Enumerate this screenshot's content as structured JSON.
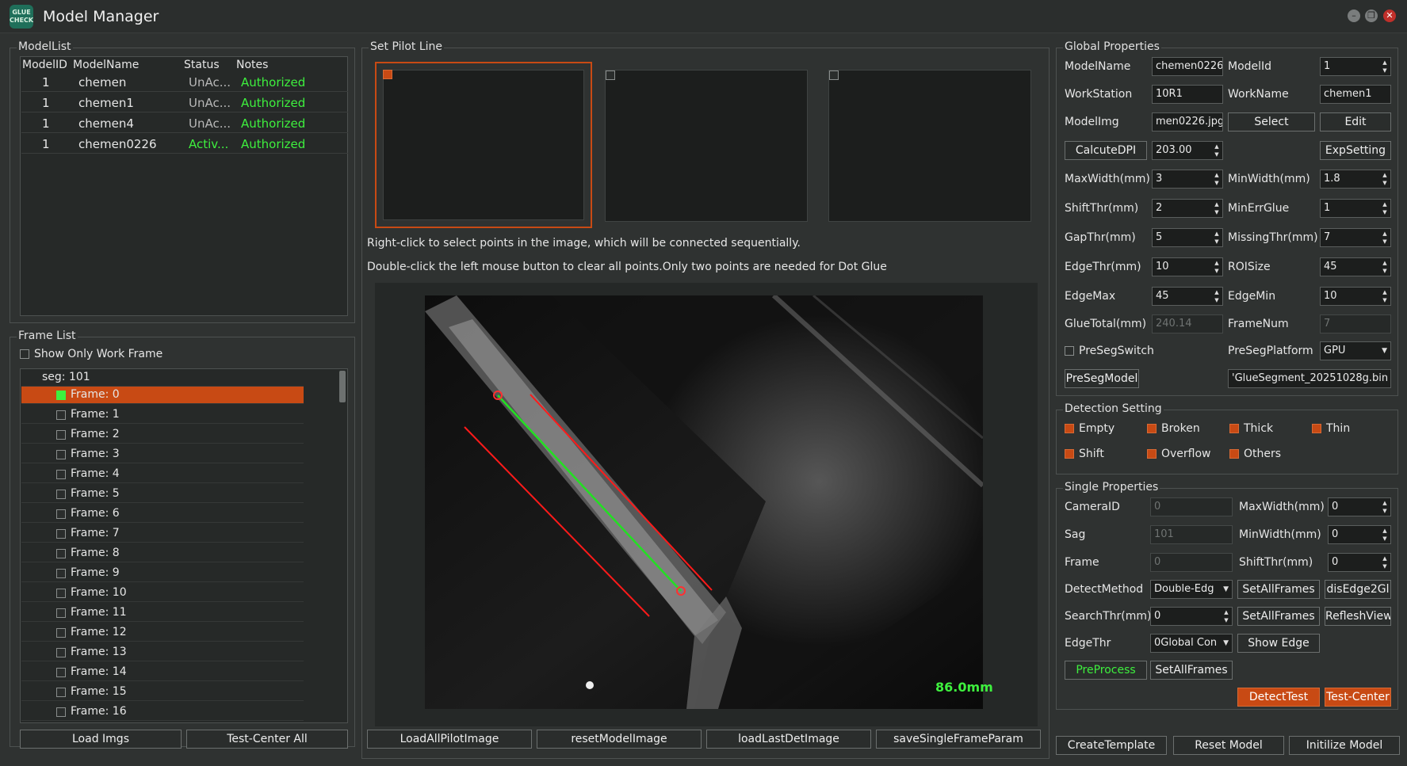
{
  "window": {
    "title": "Model Manager",
    "logo": "GLUE CHECK",
    "controls": [
      "minimize-icon",
      "restore-icon",
      "close-icon"
    ]
  },
  "modellist": {
    "title": "ModelList",
    "columns": [
      "ModelID",
      "ModelName",
      "Status",
      "Notes"
    ],
    "rows": [
      {
        "id": "1",
        "name": "chemen",
        "status": "UnAc...",
        "notes": "Authorized"
      },
      {
        "id": "1",
        "name": "chemen1",
        "status": "UnAc...",
        "notes": "Authorized"
      },
      {
        "id": "1",
        "name": "chemen4",
        "status": "UnAc...",
        "notes": "Authorized"
      },
      {
        "id": "1",
        "name": "chemen0226",
        "status": "Activ...",
        "notes": "Authorized"
      }
    ]
  },
  "framelist": {
    "title": "Frame List",
    "show_only_label": "Show Only Work Frame",
    "seg": "seg: 101",
    "frames": [
      "Frame: 0",
      "Frame: 1",
      "Frame: 2",
      "Frame: 3",
      "Frame: 4",
      "Frame: 5",
      "Frame: 6",
      "Frame: 7",
      "Frame: 8",
      "Frame: 9",
      "Frame: 10",
      "Frame: 11",
      "Frame: 12",
      "Frame: 13",
      "Frame: 14",
      "Frame: 15",
      "Frame: 16"
    ],
    "load_imgs": "Load Imgs",
    "test_center_all": "Test-Center All"
  },
  "pilot": {
    "title": "Set Pilot Line",
    "hint1": "Right-click to select points in the image, which will be connected sequentially.",
    "hint2": "Double-click the left mouse button to clear all points.Only two points are needed for Dot Glue",
    "measure": "86.0mm",
    "buttons": [
      "LoadAllPilotImage",
      "resetModelImage",
      "loadLastDetImage",
      "saveSingleFrameParam"
    ]
  },
  "global": {
    "title": "Global Properties",
    "modelname_label": "ModelName",
    "modelname": "chemen0226",
    "modelid_label": "ModelId",
    "modelid": "1",
    "workstation_label": "WorkStation",
    "workstation": "10R1",
    "workname_label": "WorkName",
    "workname": "chemen1",
    "modelimg_label": "ModelImg",
    "modelimg": "men0226.jpg",
    "select": "Select",
    "edit": "Edit",
    "calcdpi": "CalcuteDPI",
    "dpi": "203.00",
    "expsetting": "ExpSetting",
    "maxwidth_label": "MaxWidth(mm)",
    "maxwidth": "3",
    "minwidth_label": "MinWidth(mm)",
    "minwidth": "1.8",
    "shiftthr_label": "ShiftThr(mm)",
    "shiftthr": "2",
    "minerr_label": "MinErrGlue",
    "minerr": "1",
    "gapthr_label": "GapThr(mm)",
    "gapthr": "5",
    "missing_label": "MissingThr(mm)",
    "missing": "7",
    "edgethr_label": "EdgeThr(mm)",
    "edgethr": "10",
    "roisize_label": "ROISize",
    "roisize": "45",
    "edgemax_label": "EdgeMax",
    "edgemax": "45",
    "edgemin_label": "EdgeMin",
    "edgemin": "10",
    "gluetotal_label": "GlueTotal(mm)",
    "gluetotal": "240.14",
    "framenum_label": "FrameNum",
    "framenum": "7",
    "preseg_label": "PreSegSwitch",
    "platform_label": "PreSegPlatform",
    "platform": "GPU",
    "presegmodel": "PreSegModel",
    "presegfile": "'GlueSegment_20251028g.bin"
  },
  "detection": {
    "title": "Detection Setting",
    "items": [
      "Empty",
      "Broken",
      "Thick",
      "Thin",
      "Shift",
      "Overflow",
      "Others"
    ]
  },
  "single": {
    "title": "Single Properties",
    "camera_label": "CameraID",
    "camera": "0",
    "maxwidth_label": "MaxWidth(mm)",
    "maxwidth": "0",
    "sag_label": "Sag",
    "sag": "101",
    "minwidth_label": "MinWidth(mm)",
    "minwidth": "0",
    "frame_label": "Frame",
    "frame": "0",
    "shiftthr_label": "ShiftThr(mm)",
    "shiftthr": "0",
    "detectmethod_label": "DetectMethod",
    "detectmethod": "Double-Edg",
    "setall1": "SetAllFrames",
    "disedge": "disEdge2Gl",
    "searchthr_label": "SearchThr(mm)",
    "searchthr": "0",
    "setall2": "SetAllFrames",
    "refresh": "RefleshView",
    "edgethr_label": "EdgeThr",
    "edgethr": "0Global Con",
    "showedge": "Show Edge",
    "preprocess": "PreProcess",
    "setall3": "SetAllFrames",
    "detecttest": "DetectTest",
    "testcenter": "Test-Center"
  },
  "bottom": {
    "create": "CreateTemplate",
    "reset": "Reset Model",
    "init": "Initilize Model"
  },
  "colors": {
    "accent": "#c84a14",
    "green": "#3ef03e",
    "bg": "#2f3231"
  }
}
